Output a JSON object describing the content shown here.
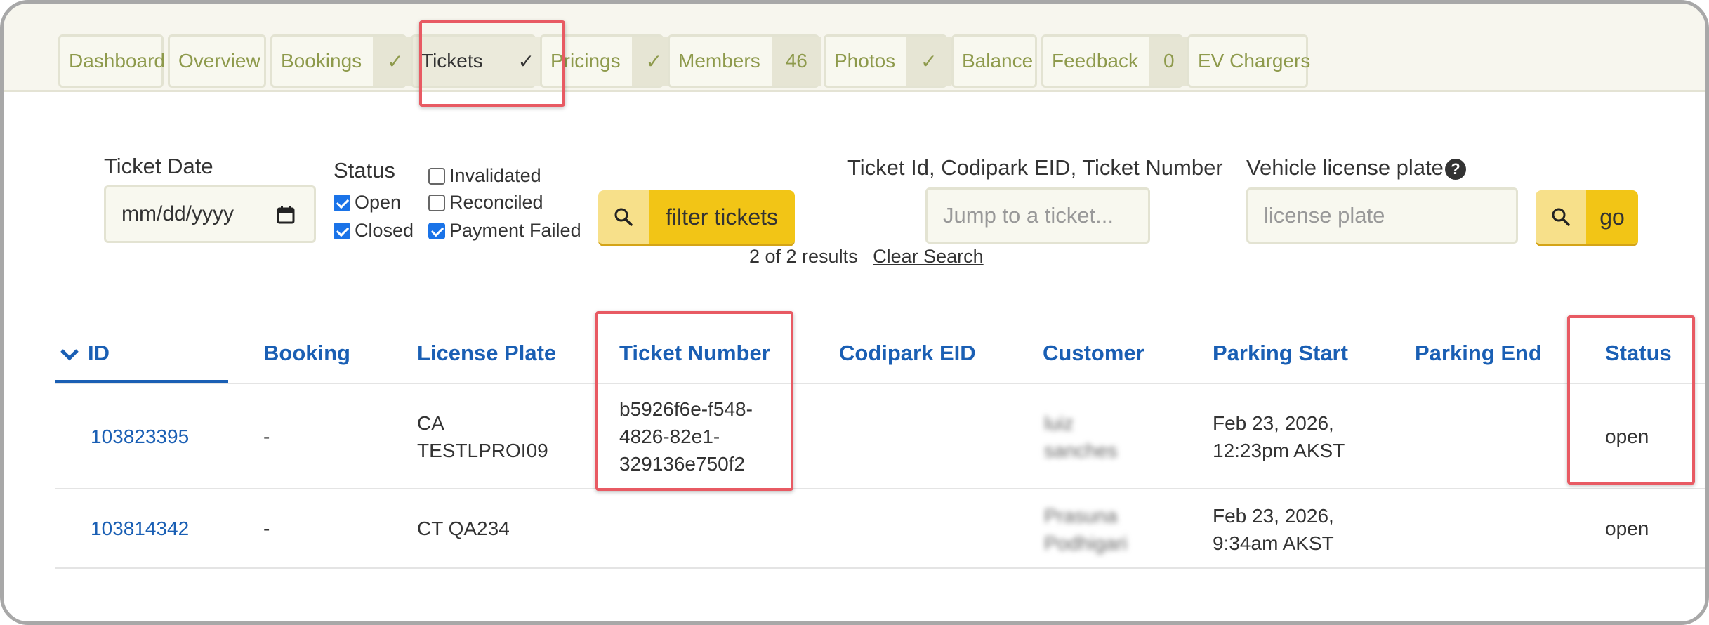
{
  "nav": {
    "tabs": [
      {
        "label": "Dashboard",
        "badge": null,
        "active": false
      },
      {
        "label": "Overview",
        "badge": null,
        "active": false
      },
      {
        "label": "Bookings",
        "badge": "✓",
        "active": false
      },
      {
        "label": "Tickets",
        "badge": "✓",
        "active": true
      },
      {
        "label": "Pricings",
        "badge": "✓",
        "active": false
      },
      {
        "label": "Members",
        "badge": "46",
        "active": false
      },
      {
        "label": "Photos",
        "badge": "✓",
        "active": false
      },
      {
        "label": "Balance",
        "badge": null,
        "active": false
      },
      {
        "label": "Feedback",
        "badge": "0",
        "active": false
      },
      {
        "label": "EV Chargers",
        "badge": null,
        "active": false
      }
    ]
  },
  "filters": {
    "ticket_date_label": "Ticket Date",
    "ticket_date_placeholder": "mm/dd/yyyy",
    "status_label": "Status",
    "checkboxes": [
      {
        "label": "Open",
        "checked": true
      },
      {
        "label": "Closed",
        "checked": true
      },
      {
        "label": "Invalidated",
        "checked": false
      },
      {
        "label": "Reconciled",
        "checked": false
      },
      {
        "label": "Payment Failed",
        "checked": true
      }
    ],
    "filter_button_label": "filter tickets",
    "results_text": "2 of 2 results",
    "clear_search_label": "Clear Search",
    "jump_label": "Ticket Id, Codipark EID, Ticket Number",
    "jump_placeholder": "Jump to a ticket...",
    "plate_label": "Vehicle license plate",
    "plate_help_icon": "?",
    "plate_placeholder": "license plate",
    "go_button_label": "go"
  },
  "table": {
    "sort_indicator": "chevron-down-icon",
    "headers": {
      "id": "ID",
      "booking": "Booking",
      "license_plate": "License Plate",
      "ticket_number": "Ticket Number",
      "codipark_eid": "Codipark EID",
      "customer": "Customer",
      "parking_start": "Parking Start",
      "parking_end": "Parking End",
      "status": "Status"
    },
    "rows": [
      {
        "id": "103823395",
        "booking": "-",
        "license_plate_line1": "CA",
        "license_plate_line2": "TESTLPROI09",
        "ticket_number_line1": "b5926f6e-f548-",
        "ticket_number_line2": "4826-82e1-",
        "ticket_number_line3": "329136e750f2",
        "codipark_eid": "",
        "customer_line1": "luiz",
        "customer_line2": "sanches",
        "parking_start_line1": "Feb 23, 2026,",
        "parking_start_line2": "12:23pm AKST",
        "parking_end": "",
        "status": "open"
      },
      {
        "id": "103814342",
        "booking": "-",
        "license_plate": "CT QA234",
        "ticket_number": "",
        "codipark_eid": "",
        "customer_line1": "Prasuna",
        "customer_line2": "Podhigari",
        "parking_start_line1": "Feb 23, 2026,",
        "parking_start_line2": "9:34am AKST",
        "parking_end": "",
        "status": "open"
      }
    ]
  },
  "colors": {
    "accent_blue": "#1a5fb4",
    "tab_text": "#8e9a4c",
    "button_yellow": "#f2c516",
    "highlight_red": "#e85a63"
  }
}
